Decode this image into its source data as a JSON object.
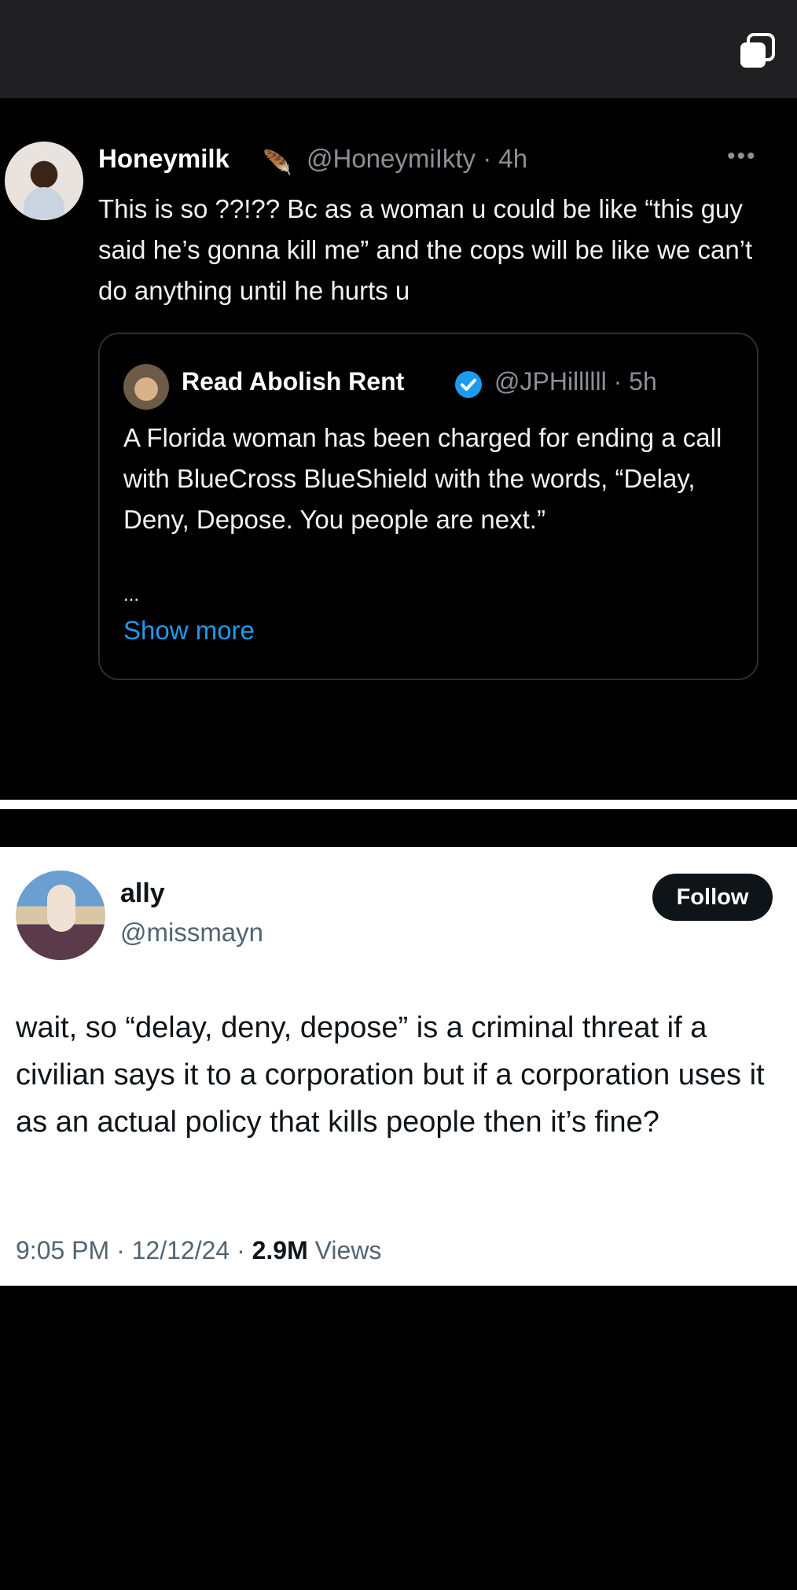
{
  "tweet1": {
    "display_name": "Honeymilk",
    "handle": "@HoneymiIkty",
    "time": "4h",
    "more_label": "•••",
    "text": "This is so ??!?? Bc as a woman u could be like “this guy said he’s gonna kill me” and the cops will be like we can’t do anything until he hurts u",
    "quoted": {
      "display_name": "Read Abolish Rent",
      "handle": "@JPHillllll",
      "time": "5h",
      "text": "A Florida woman has been charged for ending a call with BlueCross BlueShield with the words, “Delay, Deny, Depose. You people are next.”",
      "ellipsis": "...",
      "show_more": "Show more"
    }
  },
  "tweet2": {
    "display_name": "ally",
    "handle": "@missmayn",
    "follow_label": "Follow",
    "text": "wait, so “delay, deny, depose” is a criminal threat if a civilian says it to a corporation but if a corporation uses it as an actual policy that kills people then it’s fine?",
    "time": "9:05 PM",
    "date": "12/12/24",
    "views_count": "2.9M",
    "views_label": "Views"
  },
  "colors": {
    "accent_blue": "#1d9bf0",
    "dark_bg": "#000000",
    "light_bg": "#ffffff",
    "muted_text": "#8b9098"
  }
}
